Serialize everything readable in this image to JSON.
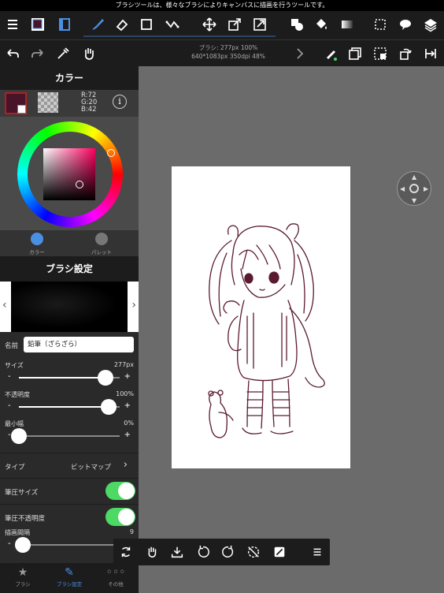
{
  "status": {
    "message": "ブラシツールは、様々なブラシによりキャンバスに描画を行うツールです。"
  },
  "toolbar": {
    "brush_info_line1": "ブラシ: 277px 100%",
    "brush_info_line2": "640*1083px 350dpi 48%"
  },
  "color_panel": {
    "title": "カラー",
    "primary_color": "#48142a",
    "rgb": {
      "r": "R:72",
      "g": "G:20",
      "b": "B:42"
    },
    "tabs": [
      {
        "label": "カラー"
      },
      {
        "label": "パレット"
      }
    ]
  },
  "brush_settings": {
    "title": "ブラシ設定",
    "name_label": "名前",
    "name_value": "鉛筆（ざらざら）",
    "sliders": [
      {
        "label": "サイズ",
        "value": "277px",
        "level": 0.86
      },
      {
        "label": "不透明度",
        "value": "100%",
        "level": 0.89
      },
      {
        "label": "最小幅",
        "value": "0%",
        "level": 0.0
      },
      {
        "label": "描画間隔",
        "value": "9",
        "level": 0.04
      }
    ],
    "type_label": "タイプ",
    "type_value": "ビットマップ",
    "toggles": [
      {
        "label": "筆圧サイズ",
        "on": true
      },
      {
        "label": "筆圧不透明度",
        "on": true
      }
    ]
  },
  "bottom_tabs": [
    {
      "label": "ブラシ",
      "icon": "star-icon"
    },
    {
      "label": "ブラシ設定",
      "icon": "brush-icon"
    },
    {
      "label": "その他",
      "icon": "more-icon"
    }
  ],
  "colors": {
    "accent": "#4a90e2",
    "toggle_on": "#4cd964",
    "sketch_line": "#5a1a30"
  }
}
